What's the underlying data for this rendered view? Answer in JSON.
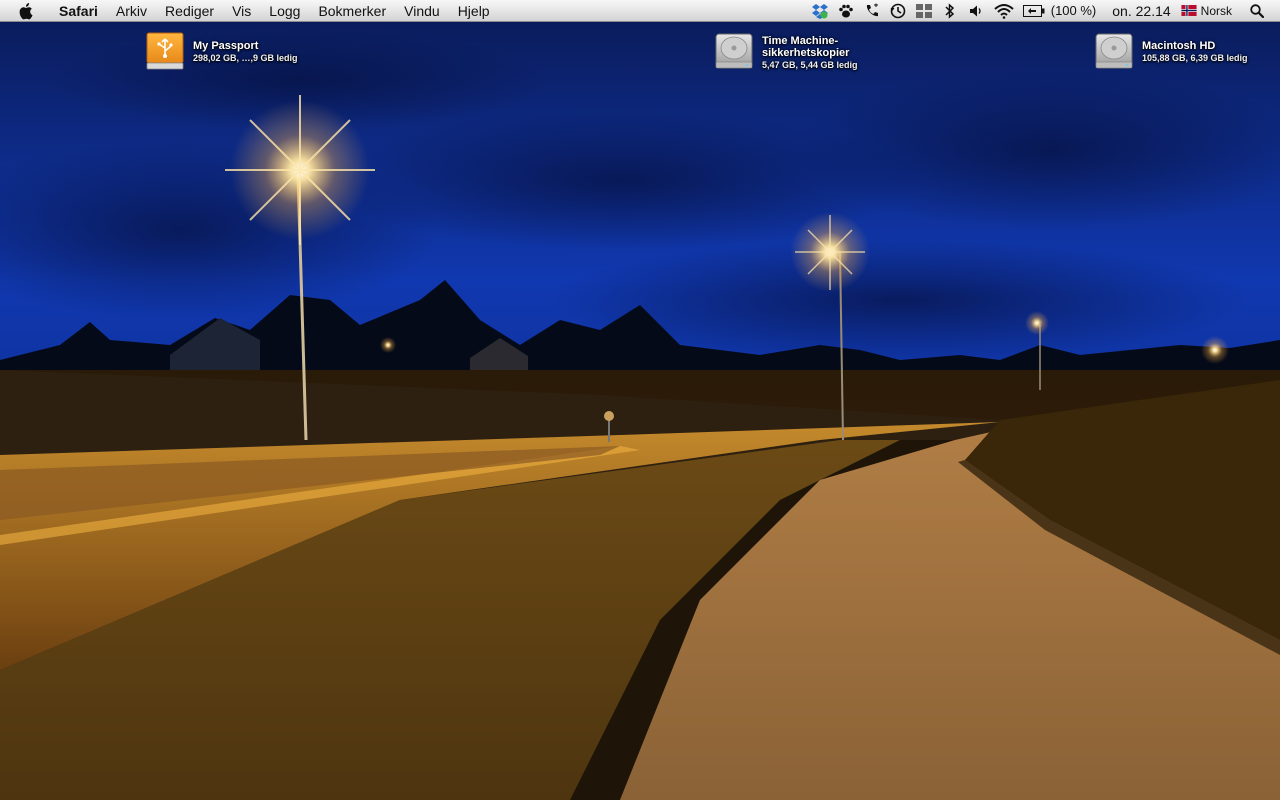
{
  "menubar": {
    "app_name": "Safari",
    "menus": [
      "Arkiv",
      "Rediger",
      "Vis",
      "Logg",
      "Bokmerker",
      "Vindu",
      "Hjelp"
    ],
    "extras": [
      "dropbox-icon",
      "paw-icon",
      "phone-icon",
      "time-machine-icon",
      "spaces-icon",
      "bluetooth-icon",
      "volume-icon",
      "wifi-icon"
    ],
    "battery_text": "(100 %)",
    "clock": "on. 22.14",
    "input_language": "Norsk"
  },
  "desktop": {
    "disks": [
      {
        "name": "My Passport",
        "info": "298,02 GB, …,9 GB ledig",
        "icon": "usb-drive-icon"
      },
      {
        "name_line1": "Time Machine-",
        "name_line2": "sikkerhetskopier",
        "info": "5,47 GB, 5,44 GB ledig",
        "icon": "hard-drive-icon"
      },
      {
        "name": "Macintosh HD",
        "info": "105,88 GB, 6,39 GB ledig",
        "icon": "hard-drive-icon"
      }
    ]
  },
  "colors": {
    "sky": "#0b2a8a",
    "lamp": "#ffe39a",
    "road": "#7a4a14",
    "grass": "#5a3a0e"
  }
}
